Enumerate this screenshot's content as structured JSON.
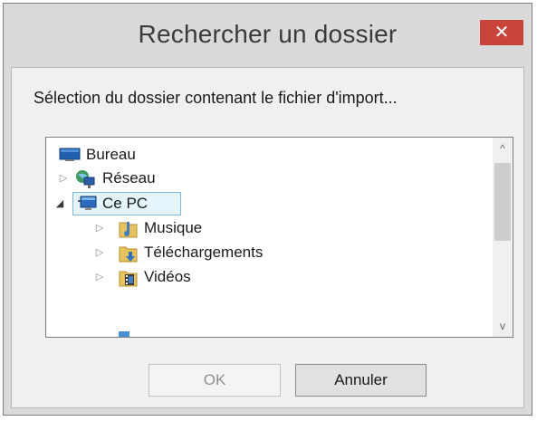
{
  "window": {
    "title": "Rechercher un dossier",
    "close_glyph": "✕",
    "accent_color": "#c9453c"
  },
  "instruction": "Sélection du dossier contenant le fichier d'import...",
  "tree": {
    "items": [
      {
        "label": "Bureau",
        "icon": "desktop-icon",
        "expander": "none",
        "selected": false
      },
      {
        "label": "Réseau",
        "icon": "network-icon",
        "expander": "collapsed",
        "selected": false
      },
      {
        "label": "Ce PC",
        "icon": "computer-icon",
        "expander": "expanded",
        "selected": true
      },
      {
        "label": "Musique",
        "icon": "music-folder-icon",
        "expander": "collapsed",
        "selected": false
      },
      {
        "label": "Téléchargements",
        "icon": "downloads-folder-icon",
        "expander": "collapsed",
        "selected": false
      },
      {
        "label": "Vidéos",
        "icon": "videos-folder-icon",
        "expander": "collapsed",
        "selected": false
      }
    ]
  },
  "scrollbar": {
    "up_glyph": "^",
    "down_glyph": "v"
  },
  "buttons": {
    "ok_label": "OK",
    "cancel_label": "Annuler"
  }
}
